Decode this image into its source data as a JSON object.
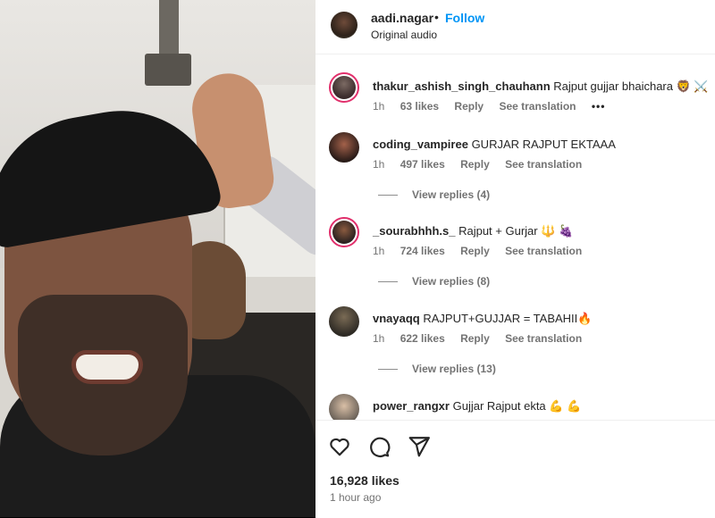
{
  "post": {
    "author": "aadi.nagar",
    "separator": "•",
    "follow_label": "Follow",
    "audio": "Original audio",
    "likes": "16,928 likes",
    "time": "1 hour ago"
  },
  "comments": [
    {
      "user": "thakur_ashish_singh_chauhann",
      "text": "Rajput gujjar bhaichara 🦁 ⚔️",
      "time": "1h",
      "likes": "63 likes",
      "reply": "Reply",
      "translate": "See translation",
      "more": "•••",
      "view_replies": ""
    },
    {
      "user": "coding_vampiree",
      "text": "GURJAR RAJPUT EKTAAA",
      "time": "1h",
      "likes": "497 likes",
      "reply": "Reply",
      "translate": "See translation",
      "more": "",
      "view_replies": "View replies (4)"
    },
    {
      "user": "_sourabhhh.s_",
      "text": "Rajput + Gurjar 🔱 🍇",
      "time": "1h",
      "likes": "724 likes",
      "reply": "Reply",
      "translate": "See translation",
      "more": "",
      "view_replies": "View replies (8)"
    },
    {
      "user": "vnayaqq",
      "text": "RAJPUT+GUJJAR = TABAHII🔥",
      "time": "1h",
      "likes": "622 likes",
      "reply": "Reply",
      "translate": "See translation",
      "more": "",
      "view_replies": "View replies (13)"
    },
    {
      "user": "power_rangxr",
      "text": "Gujjar Rajput ekta 💪 💪",
      "time": "",
      "likes": "",
      "reply": "",
      "translate": "",
      "more": "",
      "view_replies": ""
    }
  ],
  "icons": {
    "like": "heart-icon",
    "comment": "comment-icon",
    "share": "share-icon"
  },
  "colors": {
    "accent": "#0095f6",
    "text": "#262626",
    "muted": "#737373",
    "story_ring": "#e1306c"
  }
}
